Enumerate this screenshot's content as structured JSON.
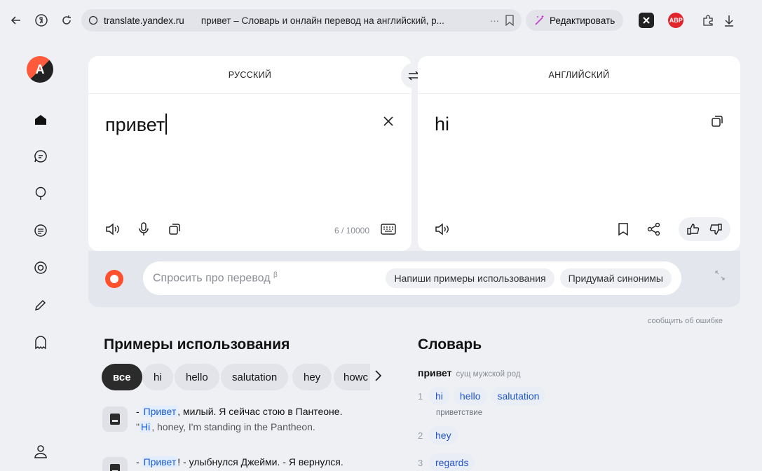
{
  "browser": {
    "domain": "translate.yandex.ru",
    "page_title": "привет – Словарь и онлайн перевод на английский, р...",
    "more_label": "···",
    "edit_label": "Редактировать",
    "ext_abp": "ABP"
  },
  "translator": {
    "source_lang": "РУССКИЙ",
    "target_lang": "АНГЛИЙСКИЙ",
    "source_text": "привет",
    "target_text": "hi",
    "char_counter": "6 / 10000"
  },
  "ask": {
    "placeholder": "Спросить про перевод",
    "beta_mark": "β",
    "chip_examples": "Напиши примеры использования",
    "chip_synonyms": "Придумай синонимы"
  },
  "report_error": "сообщить об ошибке",
  "examples": {
    "title": "Примеры использования",
    "filters": [
      "все",
      "hi",
      "hello",
      "salutation",
      "hey",
      "howc"
    ],
    "items": [
      {
        "ru_prefix": "- ",
        "ru_hl": "Привет",
        "ru_rest": ", милый. Я сейчас стою в Пантеоне.",
        "en_prefix": "\"",
        "en_hl": "Hi",
        "en_rest": ", honey, I'm standing in the Pantheon."
      },
      {
        "ru_prefix": "- ",
        "ru_hl": "Привет",
        "ru_rest": "! - улыбнулся Джейми. - Я вернулся."
      }
    ]
  },
  "dictionary": {
    "title": "Словарь",
    "headword": "привет",
    "grammar": "сущ мужской род",
    "senses": [
      {
        "num": "1",
        "words": [
          "hi",
          "hello",
          "salutation"
        ],
        "note": "приветствие"
      },
      {
        "num": "2",
        "words": [
          "hey"
        ]
      },
      {
        "num": "3",
        "words": [
          "regards"
        ]
      }
    ]
  },
  "colors": {
    "accent": "#ff4f2c",
    "link": "#1f5fd1",
    "page_bg": "#eef0f4"
  }
}
